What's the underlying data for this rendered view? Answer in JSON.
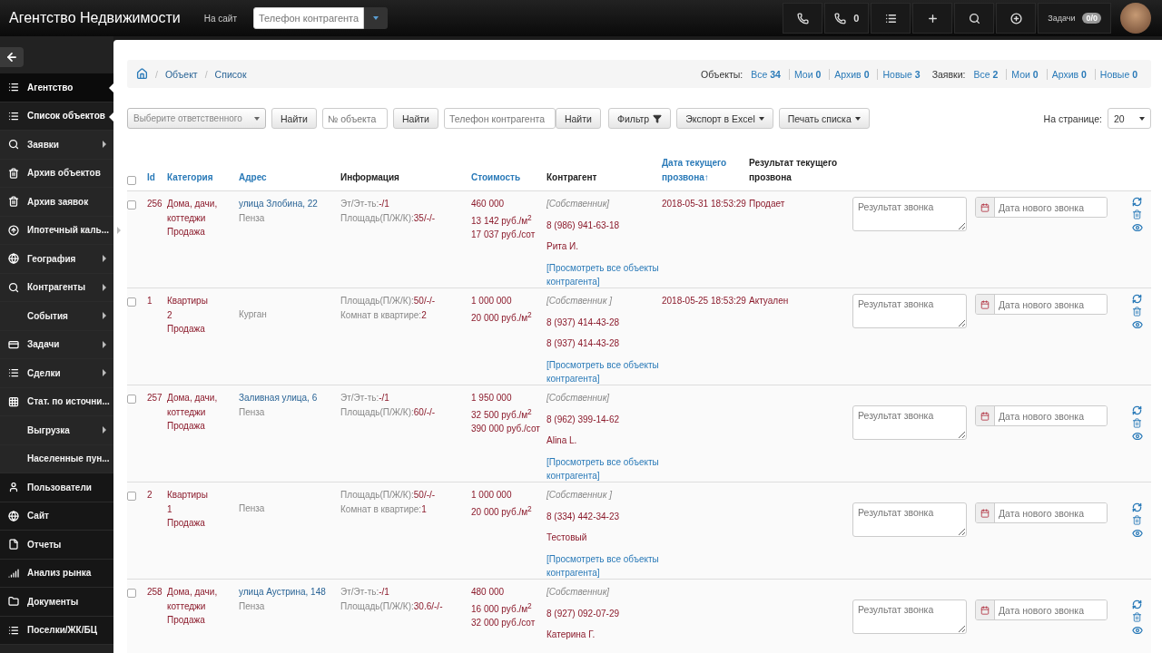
{
  "topbar": {
    "title": "Агентство Недвижимости",
    "site_link": "На сайт",
    "phone_search": {
      "placeholder": "Телефон контрагента"
    },
    "buttons": [
      {
        "kind": "phone"
      },
      {
        "kind": "phone",
        "count": "0"
      },
      {
        "kind": "list"
      },
      {
        "kind": "plus"
      },
      {
        "kind": "search"
      },
      {
        "kind": "plus-circle"
      },
      {
        "kind": "tasks",
        "label": "Задачи",
        "badge": "0/0"
      }
    ]
  },
  "sidebar": {
    "items": [
      {
        "kind": "list",
        "label": "Агентство",
        "selected": true,
        "expandable": false,
        "header": true
      },
      {
        "kind": "list",
        "label": "Список объектов",
        "selected": true,
        "expandable": false,
        "header": false
      },
      {
        "kind": "search",
        "label": "Заявки",
        "selected": false,
        "expandable": true,
        "header": false
      },
      {
        "kind": "trash",
        "label": "Архив объектов",
        "selected": false,
        "expandable": false,
        "header": false
      },
      {
        "kind": "trash",
        "label": "Архив заявок",
        "selected": false,
        "expandable": false,
        "header": false
      },
      {
        "kind": "upload",
        "label": "Ипотечный каль...",
        "selected": false,
        "expandable": true,
        "header": false
      },
      {
        "kind": "globe",
        "label": "География",
        "selected": false,
        "expandable": true,
        "header": false
      },
      {
        "kind": "search",
        "label": "Контрагенты",
        "selected": false,
        "expandable": true,
        "header": false
      },
      {
        "kind": "plain",
        "label": "События",
        "selected": false,
        "expandable": true,
        "header": false
      },
      {
        "kind": "tasks",
        "label": "Задачи",
        "selected": false,
        "expandable": true,
        "header": false
      },
      {
        "kind": "list",
        "label": "Сделки",
        "selected": false,
        "expandable": true,
        "header": false
      },
      {
        "kind": "grid",
        "label": "Стат. по источни...",
        "selected": false,
        "expandable": false,
        "header": false
      },
      {
        "kind": "plain",
        "label": "Выгрузка",
        "selected": false,
        "expandable": true,
        "header": false
      },
      {
        "kind": "plain",
        "label": "Населенные пун...",
        "selected": false,
        "expandable": false,
        "header": false
      },
      {
        "kind": "user",
        "label": "Пользователи",
        "selected": false,
        "expandable": false,
        "header": true
      },
      {
        "kind": "globe",
        "label": "Сайт",
        "selected": false,
        "expandable": false,
        "header": true
      },
      {
        "kind": "file",
        "label": "Отчеты",
        "selected": false,
        "expandable": false,
        "header": true
      },
      {
        "kind": "signal",
        "label": "Анализ рынка",
        "selected": false,
        "expandable": false,
        "header": true
      },
      {
        "kind": "folder",
        "label": "Документы",
        "selected": false,
        "expandable": false,
        "header": true
      },
      {
        "kind": "list",
        "label": "Поселки/ЖК/БЦ",
        "selected": false,
        "expandable": false,
        "header": true
      }
    ]
  },
  "breadcrumb": [
    {
      "separator": "/",
      "label": "Объект"
    },
    {
      "separator": "/",
      "label": "Список"
    }
  ],
  "stats": [
    {
      "title": "Объекты:",
      "items": [
        {
          "label": "Все",
          "count": "34"
        },
        {
          "label": "Мои",
          "count": "0"
        },
        {
          "label": "Архив",
          "count": "0"
        },
        {
          "label": "Новые",
          "count": "3"
        }
      ]
    },
    {
      "title": "Заявки:",
      "items": [
        {
          "label": "Все",
          "count": "2"
        },
        {
          "label": "Мои",
          "count": "0"
        },
        {
          "label": "Архив",
          "count": "0"
        },
        {
          "label": "Новые",
          "count": "0"
        }
      ]
    }
  ],
  "filters": {
    "responsible": {
      "placeholder": "Выберите ответственного"
    },
    "find": [
      "Найти",
      "Найти",
      "Найти"
    ],
    "object_number": {
      "placeholder": "№ объекта"
    },
    "phone": {
      "placeholder": "Телефон контрагента"
    },
    "filter": "Фильтр",
    "export": "Экспорт в Excel",
    "print": "Печать списка",
    "per_page_label": "На странице:",
    "per_page": "20"
  },
  "table": {
    "columns": [
      {
        "label": "Id",
        "sortable": true
      },
      {
        "label": "Категория",
        "sortable": true
      },
      {
        "label": "Адрес",
        "sortable": true
      },
      {
        "label": "Информация",
        "sortable": false
      },
      {
        "label": "Стоимость",
        "sortable": true
      },
      {
        "label": "Контрагент",
        "sortable": false
      },
      {
        "label": "Дата текущего прозвона↑",
        "sortable": true
      },
      {
        "label": "Результат текущего прозвона",
        "sortable": false
      }
    ],
    "select_all_checked": false,
    "rows": [
      {
        "checked": false,
        "id": "256",
        "category": [
          "Дома, дачи,",
          "коттеджи",
          "Продажа"
        ],
        "address": "улица Злобина, 22",
        "city": "Пенза",
        "info": [
          {
            "label": "Эт/Эт-ть:",
            "value": "-/1"
          },
          {
            "label": "Площадь(П/Ж/К):",
            "value": "35/-/-"
          }
        ],
        "prices": [
          "460 000",
          "13 142 руб./м$^{2}$",
          "17 037 руб./сот"
        ],
        "role": "[Собственник]",
        "contacts": [
          "8 (986) 941-63-18",
          "Рита И."
        ],
        "link": "[Просмотреть все объекты контрагента]",
        "date": "2018-05-31 18:53:29",
        "result": "Продает",
        "result_placeholder": "Результат звонка",
        "date_placeholder": "Дата нового звонка"
      },
      {
        "checked": false,
        "id": "1",
        "category": [
          "Квартиры",
          "2",
          "Продажа"
        ],
        "city": "Курган",
        "info": [
          {
            "label": "Площадь(П/Ж/К):",
            "value": "50/-/-"
          },
          {
            "label": "Комнат в квартире:",
            "value": "2"
          }
        ],
        "prices": [
          "1 000 000",
          "20 000 руб./м$^{2}$"
        ],
        "role": "[Собственник ]",
        "contacts": [
          "8 (937) 414-43-28",
          "8 (937) 414-43-28"
        ],
        "link": "[Просмотреть все объекты контрагента]",
        "date": "2018-05-25 18:53:29",
        "result": "Актуален",
        "result_placeholder": "Результат звонка",
        "date_placeholder": "Дата нового звонка"
      },
      {
        "checked": false,
        "id": "257",
        "category": [
          "Дома, дачи,",
          "коттеджи",
          "Продажа"
        ],
        "address": "Заливная улица, 6",
        "city": "Пенза",
        "info": [
          {
            "label": "Эт/Эт-ть:",
            "value": "-/1"
          },
          {
            "label": "Площадь(П/Ж/К):",
            "value": "60/-/-"
          }
        ],
        "prices": [
          "1 950 000",
          "32 500 руб./м$^{2}$",
          "390 000 руб./сот"
        ],
        "role": "[Собственник]",
        "contacts": [
          "8 (962) 399-14-62",
          "Alina L."
        ],
        "link": "[Просмотреть все объекты контрагента]",
        "result_placeholder": "Результат звонка",
        "date_placeholder": "Дата нового звонка"
      },
      {
        "checked": false,
        "id": "2",
        "category": [
          "Квартиры",
          "1",
          "Продажа"
        ],
        "city": "Пенза",
        "info": [
          {
            "label": "Площадь(П/Ж/К):",
            "value": "50/-/-"
          },
          {
            "label": "Комнат в квартире:",
            "value": "1"
          }
        ],
        "prices": [
          "1 000 000",
          "20 000 руб./м$^{2}$"
        ],
        "role": "[Собственник ]",
        "contacts": [
          "8 (334) 442-34-23",
          "Тестовый"
        ],
        "link": "[Просмотреть все объекты контрагента]",
        "result_placeholder": "Результат звонка",
        "date_placeholder": "Дата нового звонка"
      },
      {
        "checked": false,
        "id": "258",
        "category": [
          "Дома, дачи,",
          "коттеджи",
          "Продажа"
        ],
        "address": "улица Аустрина, 148",
        "city": "Пенза",
        "info": [
          {
            "label": "Эт/Эт-ть:",
            "value": "-/1"
          },
          {
            "label": "Площадь(П/Ж/К):",
            "value": "30.6/-/-"
          }
        ],
        "prices": [
          "480 000",
          "16 000 руб./м$^{2}$",
          "32 000 руб./сот"
        ],
        "role": "[Собственник]",
        "contacts": [
          "8 (927) 092-07-29",
          "Катерина Г."
        ],
        "result_placeholder": "Результат звонка",
        "date_placeholder": "Дата нового звонка"
      }
    ]
  }
}
